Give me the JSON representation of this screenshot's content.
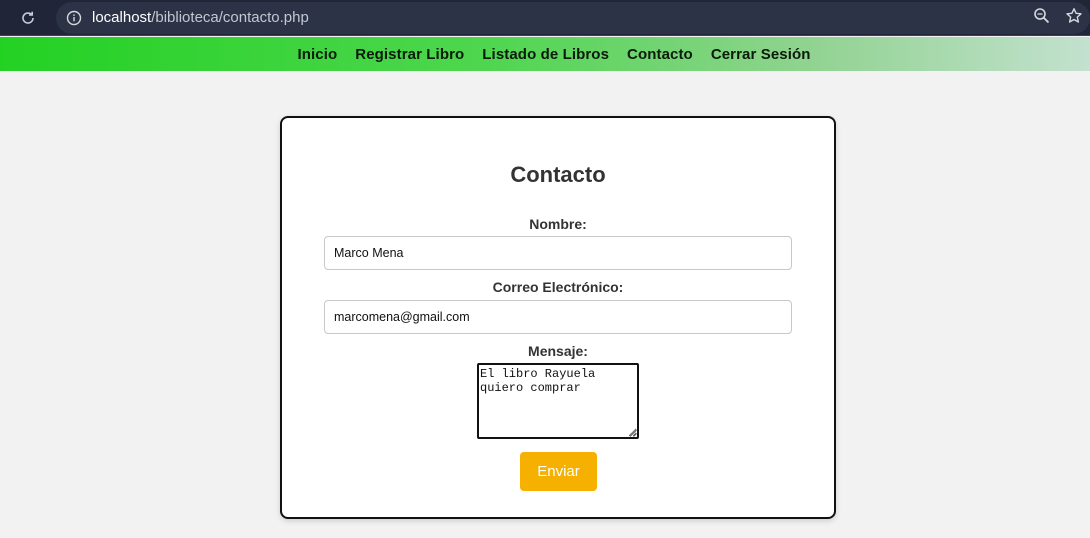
{
  "browser": {
    "url_host": "localhost",
    "url_path": "/biblioteca/contacto.php",
    "icons": {
      "reload": "reload-icon",
      "info": "info-icon",
      "zoom": "zoom-icon",
      "bookmark": "star-icon"
    }
  },
  "nav": {
    "items": [
      {
        "label": "Inicio"
      },
      {
        "label": "Registrar Libro"
      },
      {
        "label": "Listado de Libros"
      },
      {
        "label": "Contacto"
      },
      {
        "label": "Cerrar Sesión"
      }
    ]
  },
  "form": {
    "title": "Contacto",
    "name_label": "Nombre:",
    "name_value": "Marco Mena",
    "email_label": "Correo Electrónico:",
    "email_value": "marcomena@gmail.com",
    "message_label": "Mensaje:",
    "message_value": "El libro Rayuela quiero comprar",
    "submit_label": "Enviar"
  },
  "colors": {
    "submit_button": "#f5b000",
    "nav_gradient_start": "#23d123",
    "nav_gradient_end": "#c3e1cf",
    "browser_bar": "#202637"
  }
}
